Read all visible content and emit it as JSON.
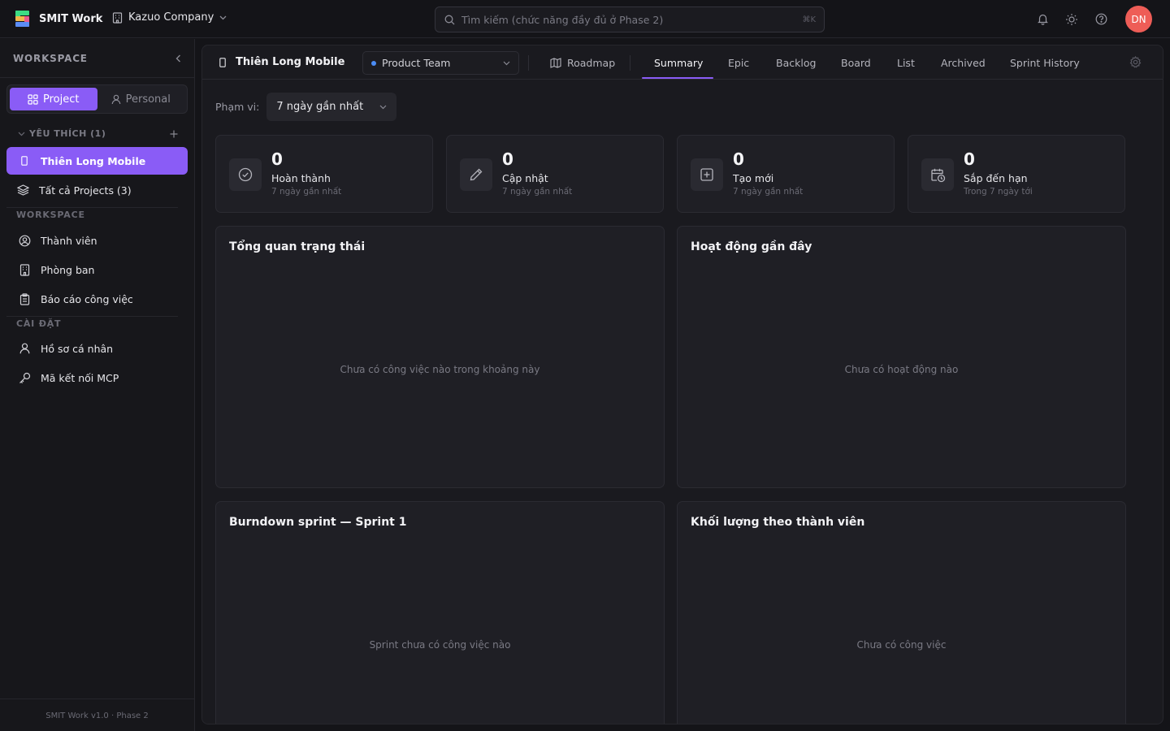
{
  "topbar": {
    "brand": "SMIT Work",
    "company": "Kazuo Company",
    "search_placeholder": "Tìm kiếm (chức năng đầy đủ ở Phase 2)",
    "search_shortcut": "⌘K",
    "avatar_initials": "DN",
    "avatar_color": "#ee5d57"
  },
  "sidebar": {
    "title": "WORKSPACE",
    "segments": [
      {
        "label": "Project",
        "active": true
      },
      {
        "label": "Personal",
        "active": false
      }
    ],
    "favorites_label": "YÊU THÍCH (1)",
    "favorite_item": "Thiên Long Mobile",
    "all_projects": "Tất cả Projects (3)",
    "workspace_section": "WORKSPACE",
    "workspace_items": [
      "Thành viên",
      "Phòng ban",
      "Báo cáo công việc"
    ],
    "settings_section": "CÀI ĐẶT",
    "settings_items": [
      "Hồ sơ cá nhân",
      "Mã kết nối MCP"
    ],
    "footer": "SMIT Work v1.0 · Phase 2",
    "accent": "#8a5cf6"
  },
  "project": {
    "title": "Thiên Long Mobile",
    "team": "Product Team",
    "team_dot_color": "#4b8cf5",
    "tabs": [
      "Roadmap",
      "Summary",
      "Epic",
      "Backlog",
      "Board",
      "List",
      "Archived",
      "Sprint History"
    ],
    "active_tab": "Summary"
  },
  "scope": {
    "label": "Phạm vi:",
    "value": "7 ngày gần nhất"
  },
  "stats": [
    {
      "value": "0",
      "label": "Hoàn thành",
      "sub": "7 ngày gần nhất",
      "icon": "check-circle-icon"
    },
    {
      "value": "0",
      "label": "Cập nhật",
      "sub": "7 ngày gần nhất",
      "icon": "pencil-icon"
    },
    {
      "value": "0",
      "label": "Tạo mới",
      "sub": "7 ngày gần nhất",
      "icon": "plus-square-icon"
    },
    {
      "value": "0",
      "label": "Sắp đến hạn",
      "sub": "Trong 7 ngày tới",
      "icon": "calendar-clock-icon"
    }
  ],
  "cards": [
    {
      "title": "Tổng quan trạng thái",
      "empty": "Chưa có công việc nào trong khoảng này"
    },
    {
      "title": "Hoạt động gần đây",
      "empty": "Chưa có hoạt động nào"
    },
    {
      "title": "Burndown sprint — Sprint 1",
      "empty": "Sprint chưa có công việc nào"
    },
    {
      "title": "Khối lượng theo thành viên",
      "empty": "Chưa có công việc"
    }
  ]
}
